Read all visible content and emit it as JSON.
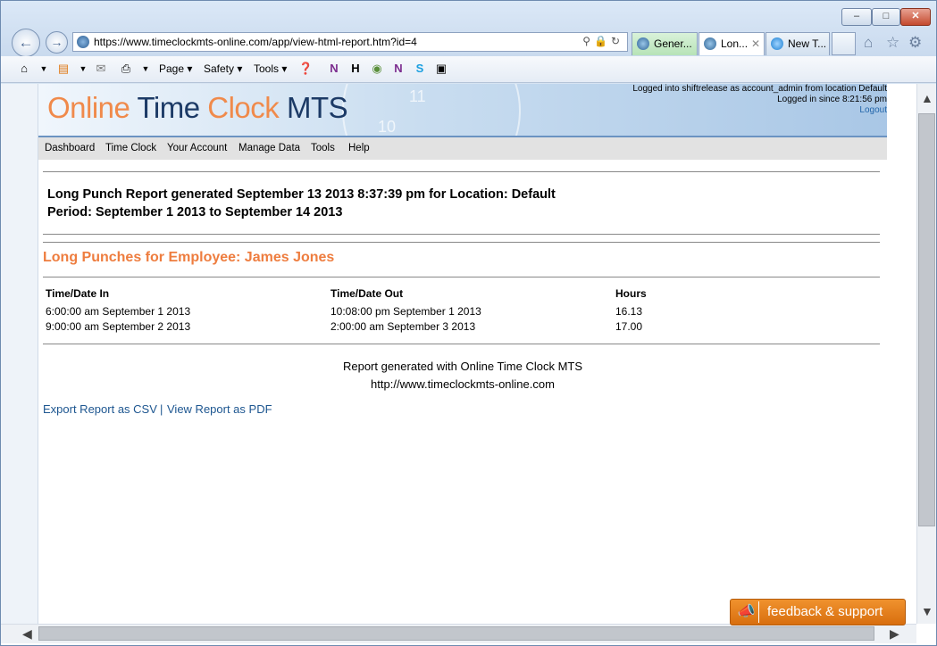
{
  "browser": {
    "address": "https://www.timeclockmts-online.com/app/view-html-report.htm?id=4",
    "tabs": [
      {
        "label": "Gener..."
      },
      {
        "label": "Lon..."
      },
      {
        "label": "New T..."
      }
    ],
    "command_bar": {
      "page": "Page",
      "safety": "Safety",
      "tools": "Tools"
    }
  },
  "header": {
    "logo": {
      "online": "Online",
      "time": "Time",
      "clock": "Clock",
      "mts": "MTS"
    },
    "clock_numbers": [
      "11",
      "10"
    ],
    "login_line1": "Logged into shiftrelease as account_admin from location Default",
    "login_line2": "Logged in since 8:21:56 pm",
    "logout": "Logout"
  },
  "menu": {
    "items": [
      "Dashboard",
      "Time Clock",
      "Your Account",
      "Manage Data",
      "Tools",
      "Help"
    ]
  },
  "report": {
    "title_line1": "Long Punch Report generated September 13 2013 8:37:39 pm for Location: Default",
    "title_line2": "Period: September 1 2013 to September 14 2013",
    "employee_heading": "Long Punches for Employee: James Jones",
    "columns": [
      "Time/Date In",
      "Time/Date Out",
      "Hours"
    ],
    "rows": [
      [
        "6:00:00 am September 1 2013",
        "10:08:00 pm September 1 2013",
        "16.13"
      ],
      [
        "9:00:00 am September 2 2013",
        "2:00:00 am September 3 2013",
        "17.00"
      ]
    ],
    "footer_line1": "Report generated with Online Time Clock MTS",
    "footer_line2": "http://www.timeclockmts-online.com",
    "export_csv": "Export Report as CSV",
    "separator": "|",
    "view_pdf": "View Report as PDF"
  },
  "feedback": {
    "label": "feedback & support"
  },
  "colors": {
    "accent_orange": "#ee7d3f",
    "link_blue": "#1d5690",
    "feedback_orange": "#e07a16"
  }
}
